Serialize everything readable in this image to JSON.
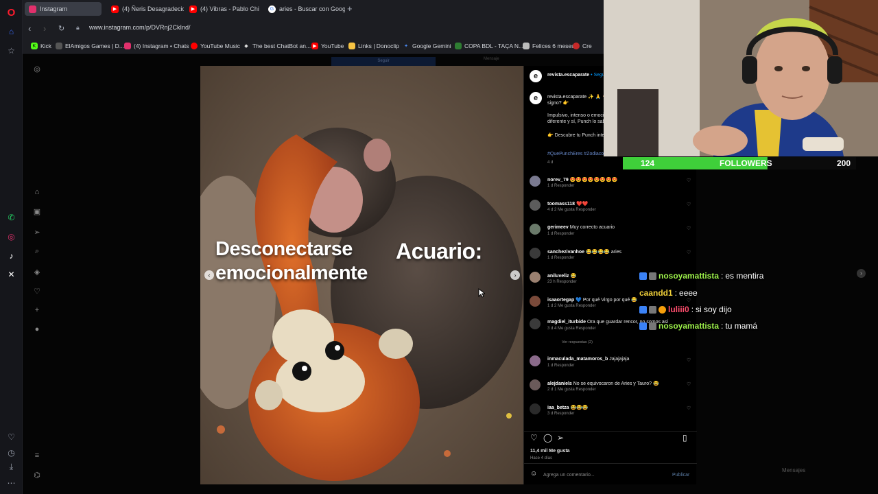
{
  "browser": {
    "tabs": [
      {
        "label": "Instagram",
        "color": "#e1306c"
      },
      {
        "label": "(4) Ñeris Desagradecidos",
        "color": "#ff0000"
      },
      {
        "label": "(4) Vibras - Pablo Chi",
        "color": "#ff0000"
      },
      {
        "label": "aries - Buscar con Google",
        "color": "#4285f4"
      }
    ],
    "new_tab": "+",
    "url": "www.instagram.com/p/DVRnj2CkInd/",
    "bookmarks": [
      {
        "label": "Kick",
        "color": "#53fc18"
      },
      {
        "label": "ElAmigos Games | D...",
        "color": "#555555"
      },
      {
        "label": "(4) Instagram • Chats",
        "color": "#e1306c"
      },
      {
        "label": "YouTube Music",
        "color": "#ff0000"
      },
      {
        "label": "The best ChatBot an...",
        "color": "#dddddd"
      },
      {
        "label": "YouTube",
        "color": "#ff0000"
      },
      {
        "label": "Links | Donoclip",
        "color": "#f6c343"
      },
      {
        "label": "Google Gemini",
        "color": "#4c8bf5"
      },
      {
        "label": "COPA BDL - TAÇA N...",
        "color": "#2e7d32"
      },
      {
        "label": "Felices 6 meses",
        "color": "#bbbbbb"
      },
      {
        "label": "Cre",
        "color": "#888888"
      }
    ]
  },
  "ig_header": {
    "follow": "Seguir",
    "message": "Mensaje"
  },
  "post": {
    "caption_left": "Desconectarse emocionalmente",
    "caption_right": "Acuario:"
  },
  "panel": {
    "author": "revista.escaparate",
    "follow": "• Seguir",
    "caption_lines": [
      "revista.escaparate ✨ 🙏 🐒 ¿Cuál es tu",
      "signo? 👉",
      "Impulsivo, intenso o emoci",
      "diferente y sí, Punch lo sab",
      "👉 Descubre tu Punch inte",
      "#QuePunchEres #Zodiaco"
    ],
    "caption_time": "4 d",
    "comments": [
      {
        "user": "norev_79",
        "text": "😍😍😍😍😍😍😍😍",
        "meta": "1 d   Responder"
      },
      {
        "user": "toomass118",
        "text": "❤️❤️",
        "meta": "4 d   2 Me gusta   Responder"
      },
      {
        "user": "gerimeev",
        "text": "Muy correcto acuario",
        "meta": "1 d   Responder"
      },
      {
        "user": "sanchezivanhoe",
        "text": "😂😂😂😂 aries",
        "meta": "1 d   Responder"
      },
      {
        "user": "aniluveliz",
        "text": "😂",
        "meta": "23 h   Responder"
      },
      {
        "user": "isaaortegap",
        "text": "💙 Por qué Virgo por qué 😂",
        "meta": "1 d   2 Me gusta   Responder"
      },
      {
        "user": "magdiel_iturbide",
        "text": "Ora que guardar rencor, no somos así",
        "meta": "3 d   4 Me gusta   Responder"
      },
      {
        "user": "inmaculada_matamoros_b",
        "text": "Jajajajaja",
        "meta": "1 d   Responder"
      },
      {
        "user": "alejdaniels",
        "text": "No se equivocaron de Aries y Tauro? 😂",
        "meta": "2 d   1 Me gusta   Responder"
      },
      {
        "user": "iaa_betza",
        "text": "😂😂😂",
        "meta": "3 d   Responder"
      }
    ],
    "replies": "Ver respuestas (2)",
    "likes": "11,4 mil Me gusta",
    "posted": "Hace 4 días",
    "comment_placeholder": "Agrega un comentario...",
    "publish": "Publicar"
  },
  "stream": {
    "followers_current": "124",
    "followers_label": "FOLLOWERS",
    "followers_goal": "200",
    "followers_progress": 0.62,
    "chat": [
      {
        "user": "nosoyamattista",
        "sep": " : ",
        "msg": "es mentira",
        "color": "#9ef34b"
      },
      {
        "user": "caandd1",
        "sep": " : ",
        "msg": "eeee",
        "color": "#f2d13a"
      },
      {
        "user": "luliii0",
        "sep": " : ",
        "msg": "si soy dijo",
        "color": "#ff4d6d"
      },
      {
        "user": "nosoyamattista",
        "sep": " : ",
        "msg": "tu mamá",
        "color": "#9ef34b"
      }
    ],
    "messages_label": "Mensajes"
  }
}
